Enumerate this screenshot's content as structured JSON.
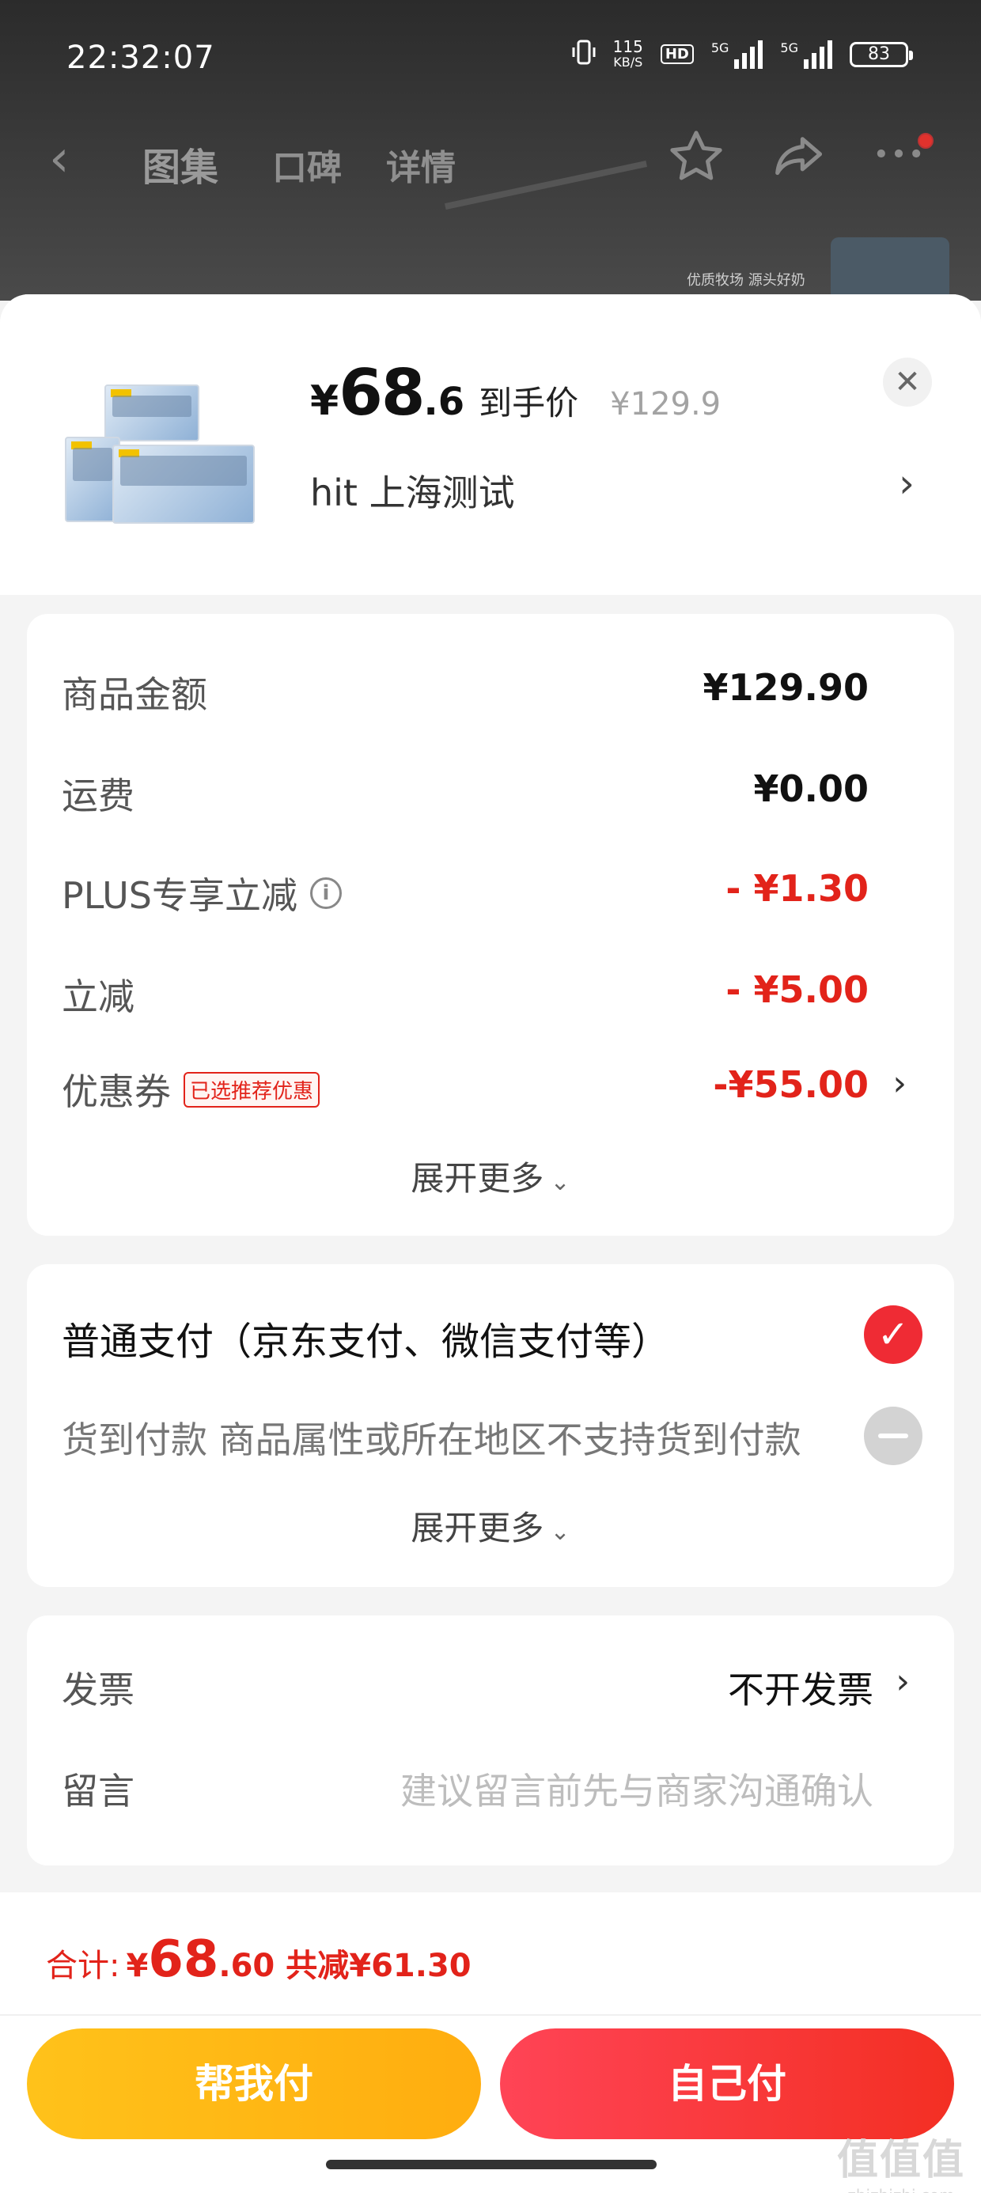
{
  "status_bar": {
    "time": "22:32:07",
    "speed_value": "115",
    "speed_unit": "KB/S",
    "hd_badge": "HD",
    "sim1_label": "5G",
    "sim2_label": "5G",
    "battery": "83"
  },
  "nav": {
    "tabs": [
      {
        "label": "图集"
      },
      {
        "label": "口碑"
      },
      {
        "label": "详情"
      }
    ],
    "background_image_text": "优质牧场 源头好奶"
  },
  "product": {
    "price_symbol": "¥",
    "price_integer": "68",
    "price_decimal": ".6",
    "price_label": "到手价",
    "original_price": "¥129.9",
    "sku_text": "hit  上海测试"
  },
  "fees": {
    "rows": [
      {
        "label": "商品金额",
        "value": "¥129.90"
      },
      {
        "label": "运费",
        "value": "¥0.00"
      },
      {
        "label": "PLUS专享立减",
        "value": "- ¥1.30"
      },
      {
        "label": "立减",
        "value": "- ¥5.00"
      },
      {
        "label": "优惠券",
        "tag": "已选推荐优惠",
        "value": "-¥55.00"
      }
    ],
    "expand_label": "展开更多"
  },
  "payment": {
    "options": [
      {
        "label": "普通支付（京东支付、微信支付等）",
        "selected": true
      },
      {
        "label": "货到付款 商品属性或所在地区不支持货到付款",
        "selected": false
      }
    ],
    "expand_label": "展开更多"
  },
  "invoice": {
    "invoice_label": "发票",
    "invoice_value": "不开发票",
    "note_label": "留言",
    "note_placeholder": "建议留言前先与商家沟通确认"
  },
  "footer": {
    "total_label": "合计:",
    "total_symbol": "¥",
    "total_integer": "68",
    "total_decimal": ".60",
    "total_savings": "共减¥61.30",
    "help_pay_button": "帮我付",
    "self_pay_button": "自己付"
  },
  "watermark": {
    "main": "值值值",
    "sub": "zhizhizhi.com"
  },
  "colors": {
    "accent_red": "#e2231a",
    "button_yellow": "#ffb812",
    "button_red": "#f5323a"
  }
}
